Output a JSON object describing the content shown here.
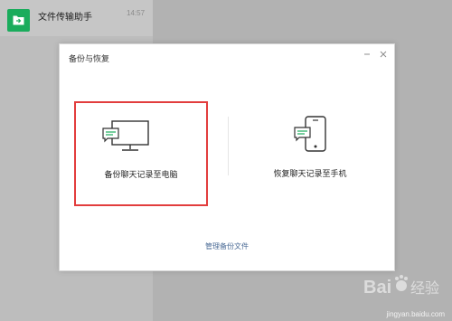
{
  "sidebar": {
    "chat": {
      "name": "文件传输助手",
      "time": "14:57"
    }
  },
  "dialog": {
    "title": "备份与恢复",
    "backup_to_pc_label": "备份聊天记录至电脑",
    "restore_to_phone_label": "恢复聊天记录至手机",
    "manage_link": "管理备份文件"
  },
  "colors": {
    "accent_green": "#1aac5c",
    "highlight_border": "#e23d3d",
    "link_blue": "#4b6b96"
  },
  "watermark": {
    "text": "Bai 经验",
    "subtext": "jingyan.baidu.com"
  }
}
